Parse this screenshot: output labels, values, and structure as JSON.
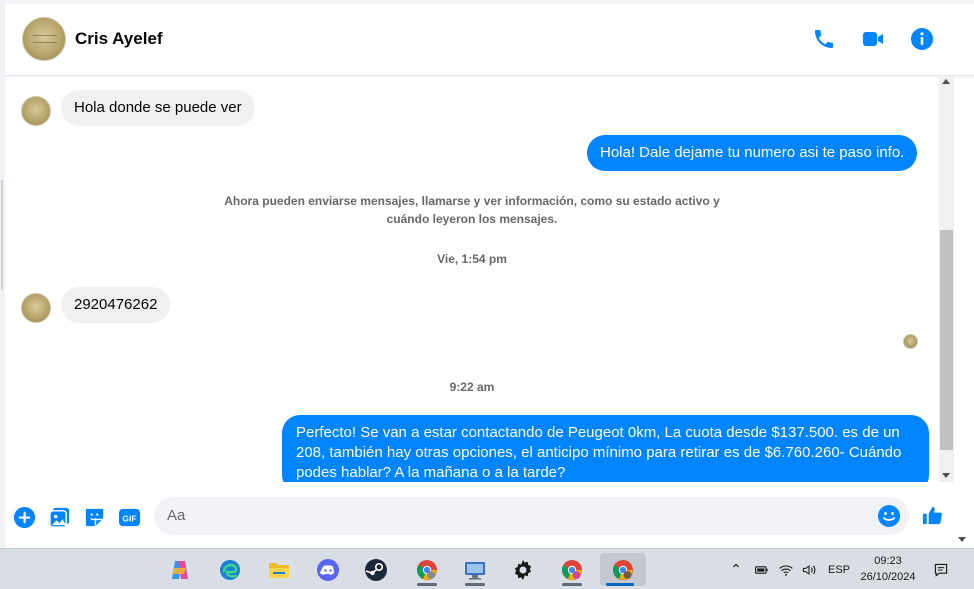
{
  "header": {
    "contact_name": "Cris Ayelef",
    "icons": [
      "phone-icon",
      "video-call-icon",
      "info-icon"
    ],
    "accent_color": "#0084ff"
  },
  "messages": {
    "m1": "Hola donde se puede ver",
    "m2": "Hola! Dale dejame tu numero  asi te paso info.",
    "system_note": "Ahora pueden enviarse mensajes, llamarse y ver información, como su estado activo y cuándo leyeron los mensajes.",
    "ts1": "Vie, 1:54 pm",
    "m3": "2920476262",
    "ts2": "9:22 am",
    "m4": "Perfecto!  Se van a estar contactando de Peugeot 0km, La cuota desde $137.500. es de un 208, también hay otras opciones, el anticipo mínimo para retirar es de $6.760.260- Cuándo podes hablar? A la mañana o a la tarde?"
  },
  "composer": {
    "placeholder": "Aa",
    "icons": [
      "add-icon",
      "photo-icon",
      "sticker-icon",
      "gif-icon",
      "emoji-icon",
      "like-icon"
    ],
    "gif_label": "GIF"
  },
  "taskbar": {
    "apps": [
      "copilot-icon",
      "edge-icon",
      "file-explorer-icon",
      "discord-icon",
      "steam-icon",
      "chrome-icon",
      "remote-desktop-icon",
      "settings-icon",
      "chrome-profile-icon",
      "chrome-profile-icon"
    ],
    "language": "ESP",
    "time": "09:23",
    "date": "26/10/2024"
  }
}
